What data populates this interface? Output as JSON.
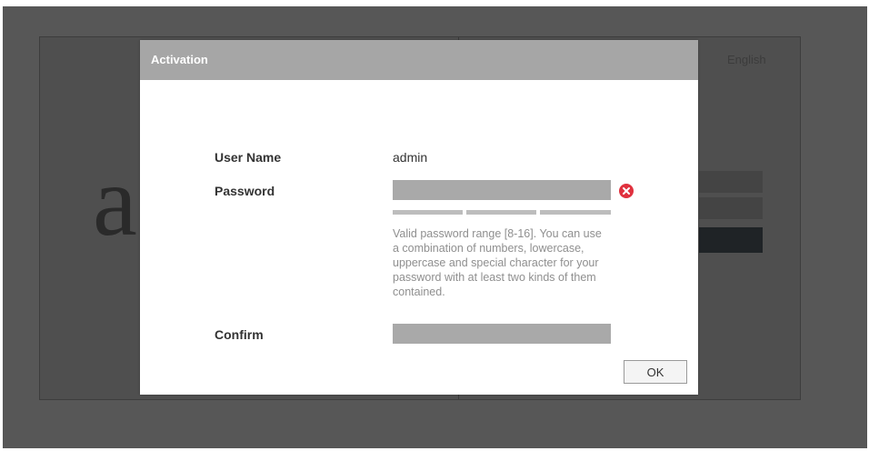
{
  "background_page": {
    "logo_text": "a",
    "language": "English"
  },
  "dialog": {
    "title": "Activation",
    "fields": {
      "username_label": "User Name",
      "username_value": "admin",
      "password_label": "Password",
      "password_value": "",
      "confirm_label": "Confirm",
      "confirm_value": ""
    },
    "password_error": true,
    "password_strength_segments": 3,
    "hint": "Valid password range [8-16]. You can use a combination of numbers, lowercase, uppercase and special character for your password with at least two kinds of them contained.",
    "ok_label": "OK"
  },
  "colors": {
    "overlay": "#575757",
    "header": "#a6a6a6",
    "field": "#a9a9a9",
    "error": "#e0313e"
  },
  "icons": {
    "password_status": "error-x-icon"
  }
}
